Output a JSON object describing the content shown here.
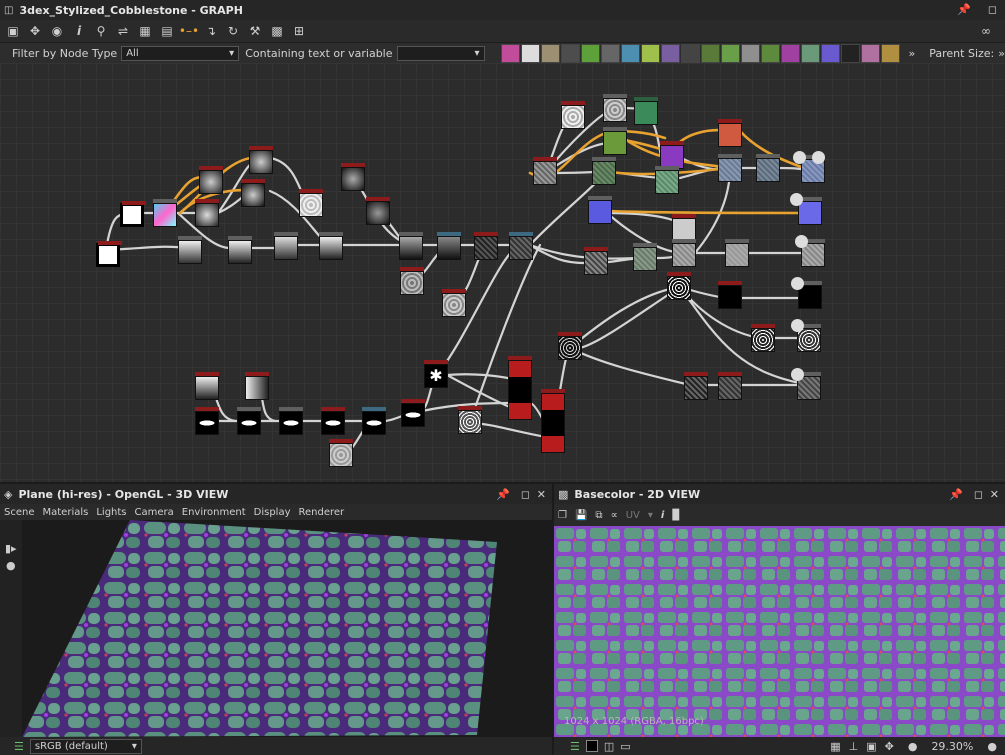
{
  "graph_title": "3dex_Stylized_Cobblestone - GRAPH",
  "filter_label": "Filter by Node Type",
  "filter_value": "All",
  "containing_label": "Containing text or variable",
  "containing_value": "",
  "parent_size_label": "Parent Size:",
  "pane3d": {
    "title": "Plane (hi-res) - OpenGL - 3D VIEW",
    "menu": [
      "Scene",
      "Materials",
      "Lights",
      "Camera",
      "Environment",
      "Display",
      "Renderer"
    ],
    "colorspace": "sRGB (default)"
  },
  "pane2d": {
    "title": "Basecolor - 2D VIEW",
    "uv_label": "UV",
    "info": "1024 x 1024 (RGBA, 16bpc)",
    "zoom": "29.30%"
  },
  "colors": {
    "accent": "#e8a230",
    "wire": "#cfcfcf",
    "node_header": "#8e1b1b"
  }
}
